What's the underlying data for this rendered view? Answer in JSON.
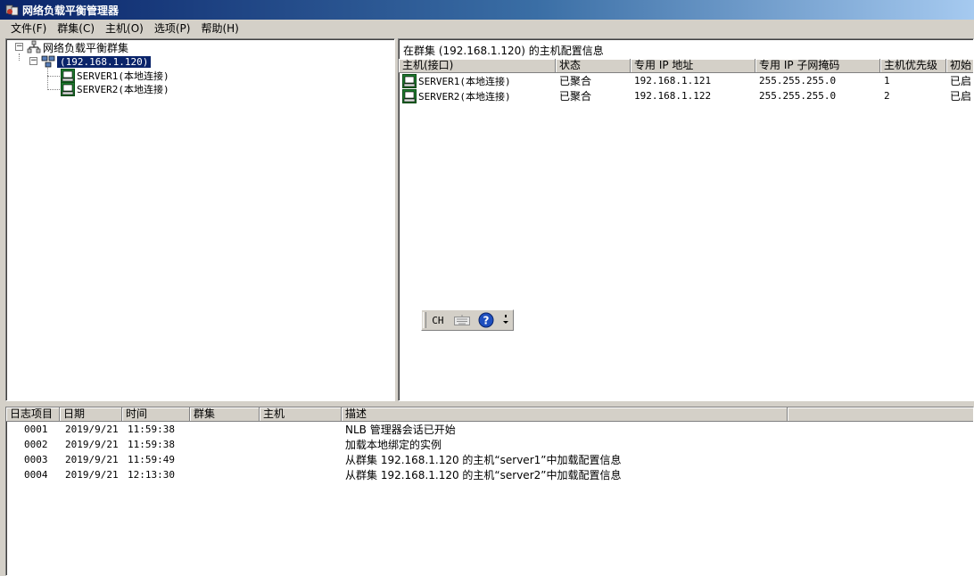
{
  "window": {
    "title": "网络负载平衡管理器",
    "icon": "nlb-manager-icon"
  },
  "menu": [
    {
      "label": "文件(F)"
    },
    {
      "label": "群集(C)"
    },
    {
      "label": "主机(O)"
    },
    {
      "label": "选项(P)"
    },
    {
      "label": "帮助(H)"
    }
  ],
  "tree": {
    "root": {
      "label": "网络负载平衡群集",
      "icon": "network-cluster-icon",
      "expander": "−"
    },
    "cluster": {
      "label": "(192.168.1.120)",
      "icon": "cluster-icon",
      "expander": "−",
      "selected": true
    },
    "hosts": [
      {
        "label": "SERVER1(本地连接)",
        "icon": "host-computer-icon"
      },
      {
        "label": "SERVER2(本地连接)",
        "icon": "host-computer-icon"
      }
    ]
  },
  "detail": {
    "title": "在群集 (192.168.1.120) 的主机配置信息",
    "columns": [
      "主机(接口)",
      "状态",
      "专用 IP 地址",
      "专用 IP 子网掩码",
      "主机优先级",
      "初始"
    ],
    "rows": [
      {
        "host": "SERVER1(本地连接)",
        "status": "已聚合",
        "ip": "192.168.1.121",
        "mask": "255.255.255.0",
        "priority": "1",
        "initial": "已启"
      },
      {
        "host": "SERVER2(本地连接)",
        "status": "已聚合",
        "ip": "192.168.1.122",
        "mask": "255.255.255.0",
        "priority": "2",
        "initial": "已启"
      }
    ]
  },
  "language_bar": {
    "lang": "CH",
    "keyboard_icon": "keyboard-icon",
    "help_icon": "help-icon",
    "options_icon": "options-arrow-icon"
  },
  "log": {
    "columns": [
      "日志项目",
      "日期",
      "时间",
      "群集",
      "主机",
      "描述"
    ],
    "rows": [
      {
        "id": "0001",
        "date": "2019/9/21",
        "time": "11:59:38",
        "cluster": "",
        "host": "",
        "desc": "NLB 管理器会话已开始"
      },
      {
        "id": "0002",
        "date": "2019/9/21",
        "time": "11:59:38",
        "cluster": "",
        "host": "",
        "desc": "加载本地绑定的实例"
      },
      {
        "id": "0003",
        "date": "2019/9/21",
        "time": "11:59:49",
        "cluster": "",
        "host": "",
        "desc": "从群集 192.168.1.120 的主机“server1”中加载配置信息"
      },
      {
        "id": "0004",
        "date": "2019/9/21",
        "time": "12:13:30",
        "cluster": "",
        "host": "",
        "desc": "从群集 192.168.1.120 的主机“server2”中加载配置信息"
      }
    ]
  },
  "colors": {
    "titlebar_start": "#0a246a",
    "titlebar_end": "#a6caf0",
    "selection": "#0a246a",
    "chrome": "#d4d0c8"
  }
}
